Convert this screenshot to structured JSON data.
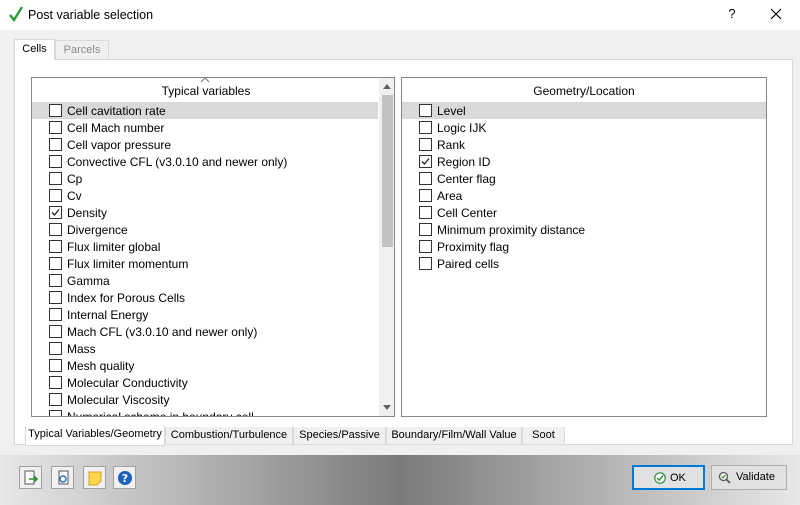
{
  "window": {
    "title": "Post variable selection",
    "help_label": "?"
  },
  "top_tabs": {
    "cells": "Cells",
    "parcels": "Parcels"
  },
  "left_panel": {
    "header": "Typical variables",
    "items": [
      {
        "label": "Cell cavitation rate",
        "checked": false,
        "selected": true
      },
      {
        "label": "Cell Mach number",
        "checked": false
      },
      {
        "label": "Cell vapor pressure",
        "checked": false
      },
      {
        "label": "Convective CFL (v3.0.10 and newer only)",
        "checked": false
      },
      {
        "label": "Cp",
        "checked": false
      },
      {
        "label": "Cv",
        "checked": false
      },
      {
        "label": "Density",
        "checked": true
      },
      {
        "label": "Divergence",
        "checked": false
      },
      {
        "label": "Flux limiter global",
        "checked": false
      },
      {
        "label": "Flux limiter momentum",
        "checked": false
      },
      {
        "label": "Gamma",
        "checked": false
      },
      {
        "label": "Index for Porous Cells",
        "checked": false
      },
      {
        "label": "Internal Energy",
        "checked": false
      },
      {
        "label": "Mach CFL (v3.0.10 and newer only)",
        "checked": false
      },
      {
        "label": "Mass",
        "checked": false
      },
      {
        "label": "Mesh quality",
        "checked": false
      },
      {
        "label": "Molecular Conductivity",
        "checked": false
      },
      {
        "label": "Molecular Viscosity",
        "checked": false
      },
      {
        "label": "Numerical scheme in boundary cell",
        "checked": false
      }
    ]
  },
  "right_panel": {
    "header": "Geometry/Location",
    "items": [
      {
        "label": "Level",
        "checked": false,
        "selected": true
      },
      {
        "label": "Logic IJK",
        "checked": false
      },
      {
        "label": "Rank",
        "checked": false
      },
      {
        "label": "Region ID",
        "checked": true
      },
      {
        "label": "Center flag",
        "checked": false
      },
      {
        "label": "Area",
        "checked": false
      },
      {
        "label": "Cell Center",
        "checked": false
      },
      {
        "label": "Minimum proximity distance",
        "checked": false
      },
      {
        "label": "Proximity flag",
        "checked": false
      },
      {
        "label": "Paired cells",
        "checked": false
      }
    ]
  },
  "bottom_tabs": {
    "typical": "Typical Variables/Geometry",
    "combustion": "Combustion/Turbulence",
    "species": "Species/Passive",
    "boundary": "Boundary/Film/Wall Value",
    "soot": "Soot"
  },
  "buttons": {
    "ok": "OK",
    "validate": "Validate"
  },
  "colors": {
    "title_check": "#2e9e36",
    "ok_border": "#0078d7",
    "selected_row": "#d9d9d9"
  }
}
